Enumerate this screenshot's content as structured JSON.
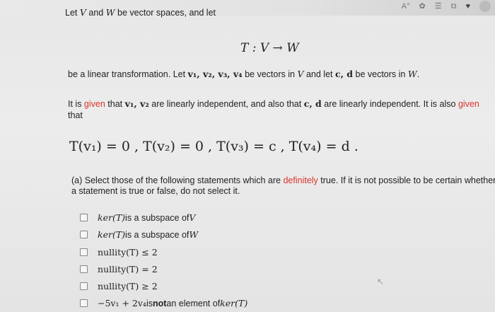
{
  "header": {
    "icons": [
      "a-icon",
      "settings-icon",
      "list-icon",
      "share-icon",
      "heart-icon",
      "avatar-icon"
    ]
  },
  "intro": {
    "line1_pre": "Let ",
    "V": "V",
    "and": " and ",
    "W": "W",
    "line1_post": " be vector spaces, and let",
    "map": "T : V → W",
    "line2_pre": "be a linear transformation. Let ",
    "vectors": "v₁, v₂, v₃, v₄",
    "line2_mid": " be vectors in ",
    "line2_mid2": " and let ",
    "cd": "c, d",
    "line2_mid3": " be vectors in ",
    "line2_end": ".",
    "given_pre": "It is ",
    "given": "given",
    "given_mid": " that ",
    "v12": "v₁, v₂",
    "given_mid2": " are linearly independent, and also that ",
    "given_mid3": " are linearly independent. It is also ",
    "given2": "given",
    "that": "that"
  },
  "equation": "T(v₁) = 0 ,   T(v₂) = 0 ,   T(v₃) = c ,   T(v₄) = d .",
  "question": {
    "pre": "(a) Select those of the following statements which are ",
    "definitely": "definitely",
    "post": " true.  If it is not possible to be certain whether",
    "line2": "a statement is true or false, do not select it."
  },
  "options": [
    {
      "math": "ker(T)",
      "text": " is a subspace of ",
      "end": "V"
    },
    {
      "math": "ker(T)",
      "text": " is a subspace of ",
      "end": "W"
    },
    {
      "math": "nullity(T) ≤ 2",
      "text": "",
      "end": ""
    },
    {
      "math": "nullity(T) = 2",
      "text": "",
      "end": ""
    },
    {
      "math": "nullity(T) ≥ 2",
      "text": "",
      "end": ""
    },
    {
      "math": "−5v₁ + 2v₄",
      "text": " is ",
      "bold": "not",
      "text2": " an element of ",
      "end": "ker(T)"
    }
  ],
  "colors": {
    "accent": "#d9362b",
    "text": "#222222",
    "background": "#e8e8e8"
  }
}
